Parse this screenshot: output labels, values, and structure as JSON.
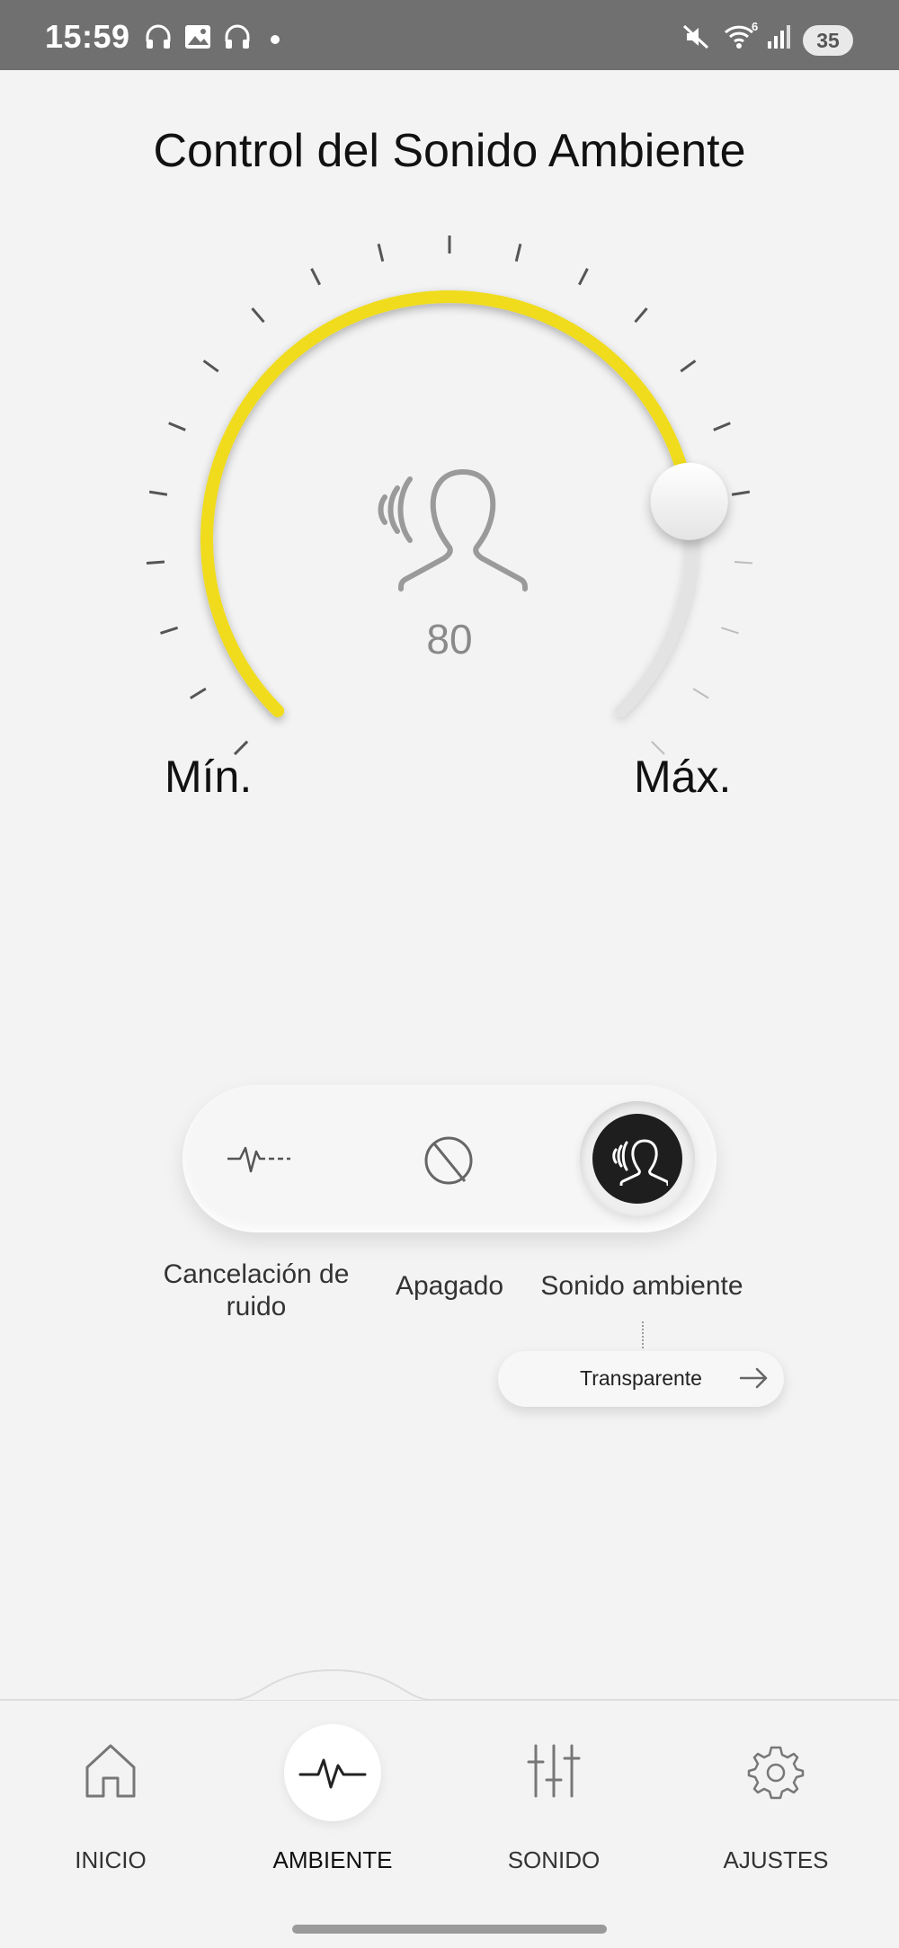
{
  "status_bar": {
    "time": "15:59",
    "battery": "35",
    "icons": [
      "headphones-icon",
      "image-icon",
      "headphones-icon",
      "dot-icon",
      "mute-icon",
      "wifi-6-icon",
      "signal-icon",
      "battery-icon"
    ]
  },
  "page_title": "Control del Sonido Ambiente",
  "dial": {
    "value": "80",
    "level_fraction": 0.8,
    "min_label": "Mín.",
    "max_label": "Máx.",
    "accent_color": "#f0dc1a",
    "icon": "ambient-person-icon"
  },
  "mode_switch": {
    "options": [
      {
        "label_line1": "Cancelación de",
        "label_line2": "ruido",
        "icon": "noise-cancel-icon"
      },
      {
        "label": "Apagado",
        "icon": "off-icon"
      },
      {
        "label": "Sonido ambiente",
        "icon": "ambient-person-icon"
      }
    ],
    "selected": "Sonido ambiente"
  },
  "transparent_button": {
    "label": "Transparente",
    "icon": "arrow-right-icon"
  },
  "bottom_nav": {
    "items": [
      {
        "label": "INICIO",
        "icon": "home-icon"
      },
      {
        "label": "AMBIENTE",
        "icon": "pulse-icon"
      },
      {
        "label": "SONIDO",
        "icon": "equalizer-icon"
      },
      {
        "label": "AJUSTES",
        "icon": "gear-icon"
      }
    ],
    "active": "AMBIENTE"
  }
}
